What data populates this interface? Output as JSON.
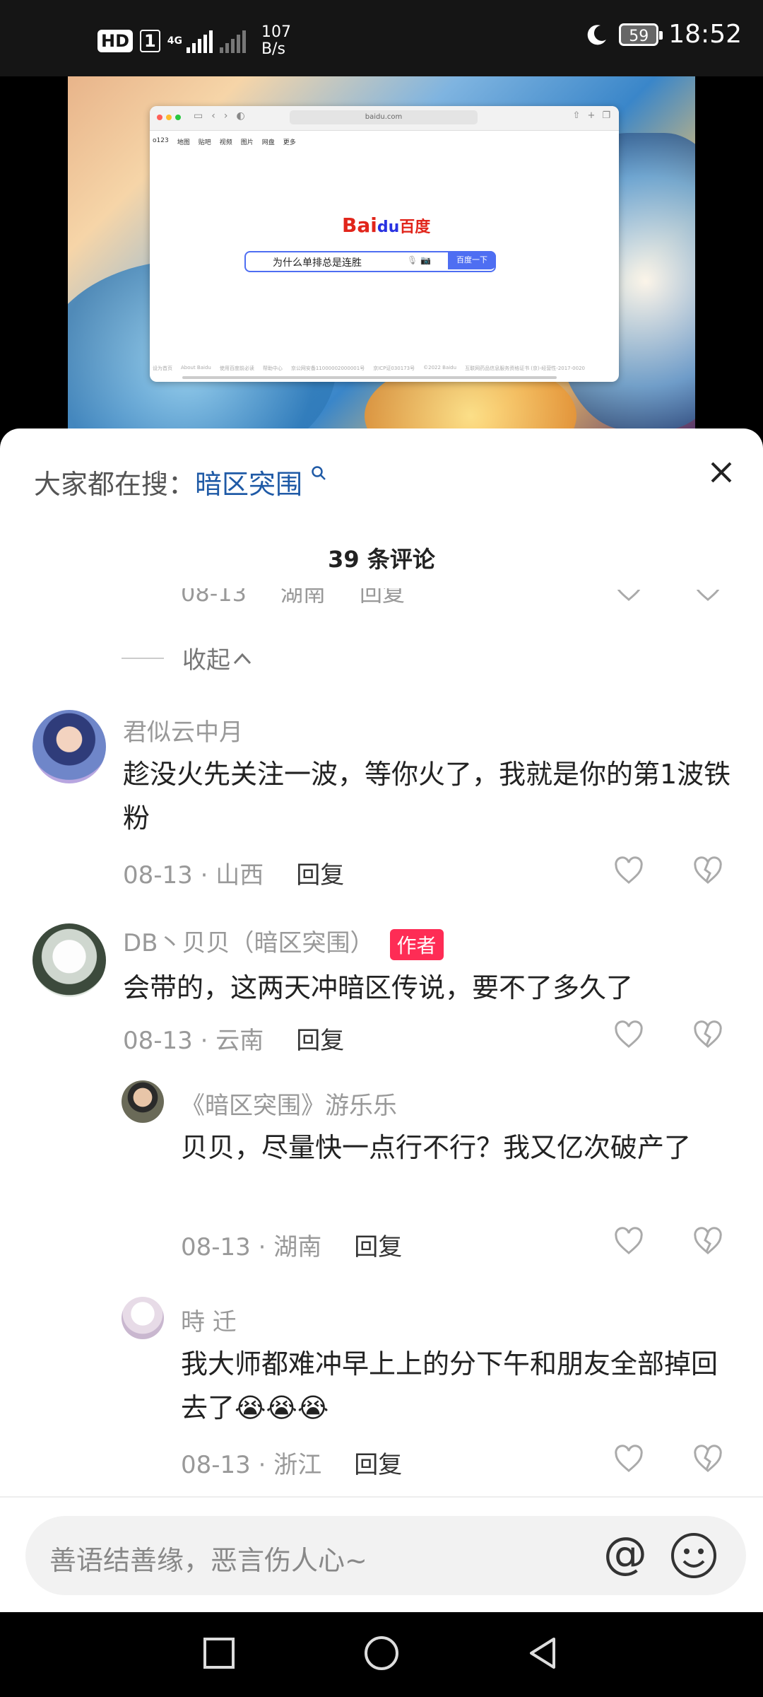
{
  "status_bar": {
    "hd": "HD",
    "sim": "1",
    "network": "4G",
    "speed_value": "107",
    "speed_unit": "B/s",
    "battery": "59",
    "time": "18:52"
  },
  "browser": {
    "url": "baidu.com",
    "nav_links": [
      "o123",
      "地图",
      "贴吧",
      "视频",
      "图片",
      "网盘",
      "更多"
    ],
    "logo_bai": "Bai",
    "logo_du": "du",
    "logo_cn": "百度",
    "query": "为什么单排总是连胜",
    "search_button": "百度一下",
    "footer_links": [
      "设为首页",
      "About Baidu",
      "使用百度前必读",
      "帮助中心",
      "京公网安备11000002000001号",
      "京ICP证030173号",
      "©2022 Baidu",
      "互联网药品信息服务资格证书 (京)-经营性-2017-0020"
    ]
  },
  "sheet": {
    "hot_label": "大家都在搜：",
    "hot_keyword": "暗区突围",
    "comment_count": "39 条评论",
    "collapse_label": "收起",
    "input_placeholder": "善语结善缘，恶言伤人心~",
    "at_symbol": "@"
  },
  "ghost_row": {
    "date": "08-13",
    "region": "湖南",
    "reply": "回复"
  },
  "comments": [
    {
      "user": "君似云中月",
      "text": "趁没火先关注一波，等你火了，我就是你的第1波铁粉",
      "date": "08-13",
      "region": "山西",
      "reply": "回复"
    },
    {
      "user": "DB丶贝贝（暗区突围）",
      "badge": "作者",
      "text": "会带的，这两天冲暗区传说，要不了多久了",
      "date": "08-13",
      "region": "云南",
      "reply": "回复"
    },
    {
      "user": "《暗区突围》游乐乐",
      "text": "贝贝，尽量快一点行不行？我又亿次破产了",
      "date": "08-13",
      "region": "湖南",
      "reply": "回复"
    },
    {
      "user": "時 迁",
      "text": "我大师都难冲早上上的分下午和朋友全部掉回去了",
      "emoji": "😭😭😭",
      "date": "08-13",
      "region": "浙江",
      "reply": "回复"
    }
  ],
  "icons": {
    "heart": "heart-icon",
    "dislike": "broken-heart-icon",
    "search": "search-icon",
    "close": "close-icon"
  }
}
